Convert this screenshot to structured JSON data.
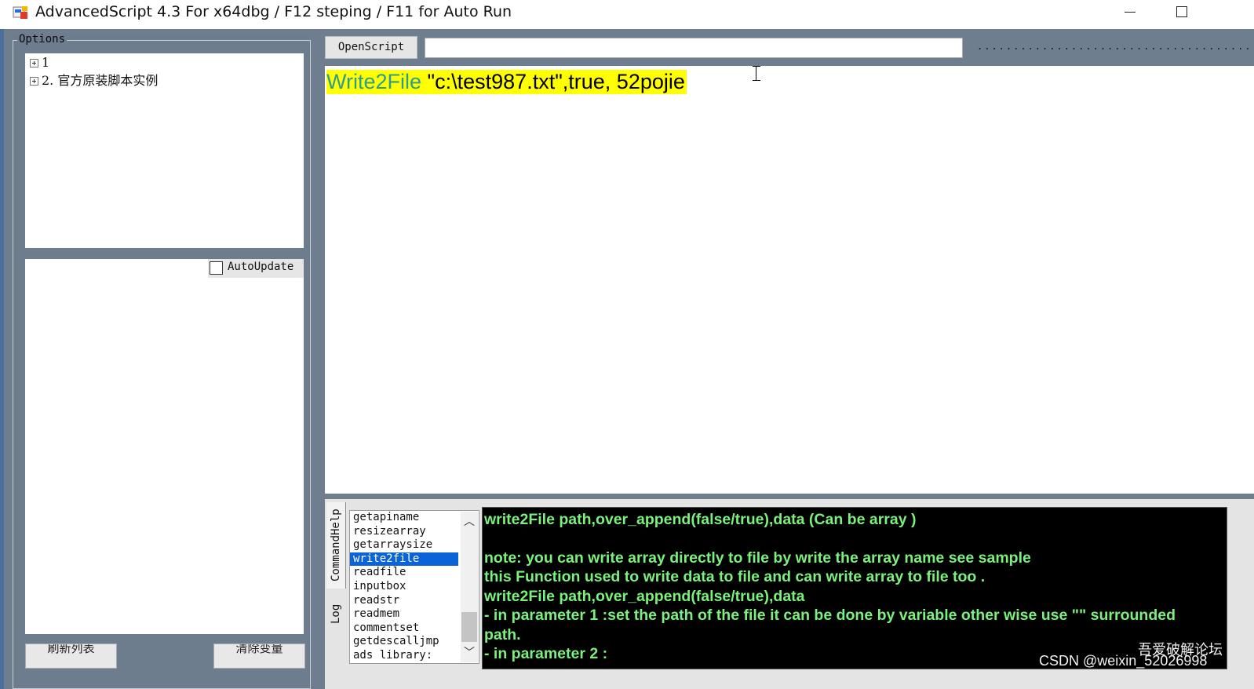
{
  "window": {
    "title": "AdvancedScript 4.3 For x64dbg / F12 steping / F11 for Auto Run"
  },
  "options": {
    "legend": "Options",
    "tree": [
      "1",
      "2. 官方原装脚本实例"
    ],
    "autoupdate_label": "AutoUpdate",
    "autoupdate_checked": false,
    "refresh_button": "刷新列表",
    "clear_button": "清除变量"
  },
  "toolbar": {
    "openscript_label": "OpenScript",
    "path_value": "",
    "dots": "................................................"
  },
  "editor": {
    "keyword": "Write2File",
    "rest": " \"c:\\test987.txt\",true, 52pojie"
  },
  "tabs": {
    "commandhelp": "CommandHelp",
    "log": "Log"
  },
  "commands": {
    "items": [
      "getapiname",
      "resizearray",
      "getarraysize",
      "write2file",
      "readfile",
      "inputbox",
      "readstr",
      "readmem",
      "commentset",
      "getdescalljmp",
      "ads library:"
    ],
    "selected": "write2file"
  },
  "help": {
    "lines": [
      "write2File path,over_append(false/true),data (Can be array )",
      "",
      "note: you can write array directly to file by write the array name see sample",
      "this Function used to write data to file and can write array to file too .",
      "write2File path,over_append(false/true),data",
      " - in parameter 1 :set the path of the file it can be done by variable other wise use \"\" surrounded",
      "path.",
      " - in parameter 2 :"
    ]
  },
  "watermark": {
    "csdn": "CSDN @weixin_52026998",
    "forum": "吾爱破解论坛"
  },
  "colors": {
    "client_bg": "#6f7e8e",
    "keyword": "#2a9d8f",
    "highlight": "#ffff00",
    "help_text": "#7cf07c",
    "selection": "#0a64d8"
  }
}
